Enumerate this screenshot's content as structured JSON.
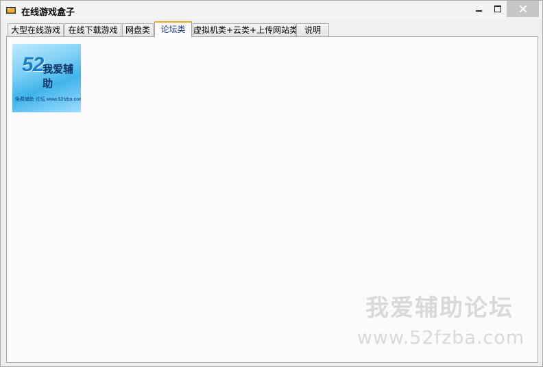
{
  "window": {
    "title": "在线游戏盒子",
    "icons": {
      "app": "folder-app-icon",
      "minimize": "minimize-icon",
      "maximize": "maximize-icon",
      "close": "close-icon"
    }
  },
  "tabs": [
    {
      "label": "大型在线游戏",
      "active": false
    },
    {
      "label": "在线下载游戏",
      "active": false
    },
    {
      "label": "网盘类",
      "active": false
    },
    {
      "label": "论坛类",
      "active": true
    },
    {
      "label": "虚拟机类+云类+上传网站类",
      "active": false
    },
    {
      "label": "说明",
      "active": false
    }
  ],
  "panel": {
    "banner": {
      "number": "52",
      "name": "我爱辅助",
      "tagline": "免费辅助 论坛 www.52fzba.com"
    },
    "watermark": {
      "name": "我爱辅助论坛",
      "url": "www.52fzba.com"
    }
  },
  "colors": {
    "active_tab_accent": "#f5a623",
    "panel_bg": "#fbfbfe",
    "watermark": "#d9d9d9"
  }
}
